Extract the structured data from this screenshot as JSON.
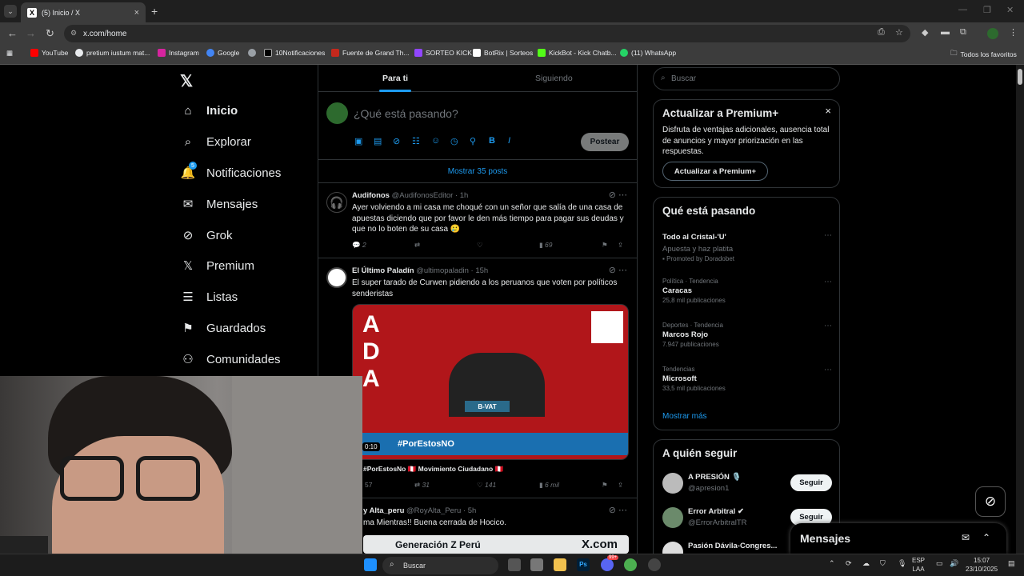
{
  "browser": {
    "tab_title": "(5) Inicio / X",
    "tab_close": "×",
    "new_tab": "+",
    "url": "x.com/home",
    "bookmarks": [
      {
        "label": "YouTube",
        "color": "#ff0000"
      },
      {
        "label": "pretium iustum mat...",
        "color": "#e8eaed"
      },
      {
        "label": "Instagram",
        "color": "#d6249f"
      },
      {
        "label": "Google",
        "color": "#4285f4"
      },
      {
        "label": "",
        "color": "#9aa0a6"
      },
      {
        "label": "10Notificaciones",
        "color": "#000000"
      },
      {
        "label": "Fuente de Grand Th...",
        "color": "#c4281c"
      },
      {
        "label": "SORTEO KICK",
        "color": "#9146ff"
      },
      {
        "label": "BotRix | Sorteos",
        "color": "#ffffff"
      },
      {
        "label": "KickBot - Kick Chatb...",
        "color": "#53fc18"
      },
      {
        "label": "(11) WhatsApp",
        "color": "#25d366"
      }
    ],
    "all_bookmarks": "Todos los favoritos"
  },
  "nav": {
    "logo": "𝕏",
    "items": [
      {
        "label": "Inicio",
        "icon": "⌂"
      },
      {
        "label": "Explorar",
        "icon": "⌕"
      },
      {
        "label": "Notificaciones",
        "icon": "🔔",
        "badge": "5"
      },
      {
        "label": "Mensajes",
        "icon": "✉"
      },
      {
        "label": "Grok",
        "icon": "⊘"
      },
      {
        "label": "Premium",
        "icon": "𝕏"
      },
      {
        "label": "Listas",
        "icon": "☰"
      },
      {
        "label": "Guardados",
        "icon": "⚑"
      },
      {
        "label": "Comunidades",
        "icon": "⚇"
      }
    ]
  },
  "feed": {
    "tabs": [
      "Para ti",
      "Siguiendo"
    ],
    "compose_placeholder": "¿Qué está pasando?",
    "post_button": "Postear",
    "show_more": "Mostrar 35 posts",
    "tweets": [
      {
        "name": "Audifonos",
        "handle": "@AudifonosEditor",
        "time": "· 1h",
        "text": "Ayer volviendo a mi casa me choqué con un señor que salía de una casa de apuestas diciendo que por favor le den más tiempo para pagar sus deudas y que no lo boten de su casa 🥲",
        "replies": "2",
        "reposts": "",
        "likes": "",
        "views": "69"
      },
      {
        "name": "El Último Paladín",
        "handle": "@ultimopaladin",
        "time": "· 15h",
        "text": "El super tarado de Curwen pidiendo a los peruanos que voten por políticos senderistas",
        "media_caption": "#PorEstosNo 🇵🇪 Movimiento Ciudadano 🇵🇪",
        "media_time": "0:10",
        "media_banner": "#PorEstosNO",
        "media_sign": "B-VAT",
        "replies": "57",
        "reposts": "31",
        "likes": "141",
        "views": "6 mil"
      },
      {
        "name": "y Alta_peru",
        "handle": "@RoyAlta_Peru",
        "time": "· 5h",
        "text": "ma Mientras!! Buena cerrada de Hocico.",
        "media_banner": "Generación Z Perú",
        "media_brand": "X.com"
      }
    ]
  },
  "sidebar": {
    "search_placeholder": "Buscar",
    "premium": {
      "title": "Actualizar a Premium+",
      "text": "Disfruta de ventajas adicionales, ausencia total de anuncios y mayor priorización en las respuestas.",
      "button": "Actualizar a Premium+",
      "close": "×"
    },
    "trends": {
      "title": "Qué está pasando",
      "items": [
        {
          "category": "",
          "name": "Todo al Cristal-'U'",
          "count": "Apuesta y haz platita",
          "promo": "Promoted by Doradobet"
        },
        {
          "category": "Política · Tendencia",
          "name": "Caracas",
          "count": "25,8 mil publicaciones",
          "promo": ""
        },
        {
          "category": "Deportes · Tendencia",
          "name": "Marcos Rojo",
          "count": "7.947 publicaciones",
          "promo": ""
        },
        {
          "category": "Tendencias",
          "name": "Microsoft",
          "count": "33,5 mil publicaciones",
          "promo": ""
        }
      ],
      "show_more": "Mostrar más"
    },
    "follow": {
      "title": "A quién seguir",
      "items": [
        {
          "name": "A PRESIÓN 🎙️",
          "handle": "@apresion1",
          "button": "Seguir"
        },
        {
          "name": "Error Arbitral ✔",
          "handle": "@ErrorArbitralTR",
          "button": "Seguir"
        },
        {
          "name": "Pasión Dávila-Congres...",
          "handle": "",
          "button": ""
        }
      ]
    },
    "messages_drawer": "Mensajes"
  },
  "taskbar": {
    "search": "Buscar",
    "lang": "ESP",
    "lang2": "LAA",
    "time": "15:07",
    "date": "23/10/2025",
    "discord_badge": "99+"
  }
}
